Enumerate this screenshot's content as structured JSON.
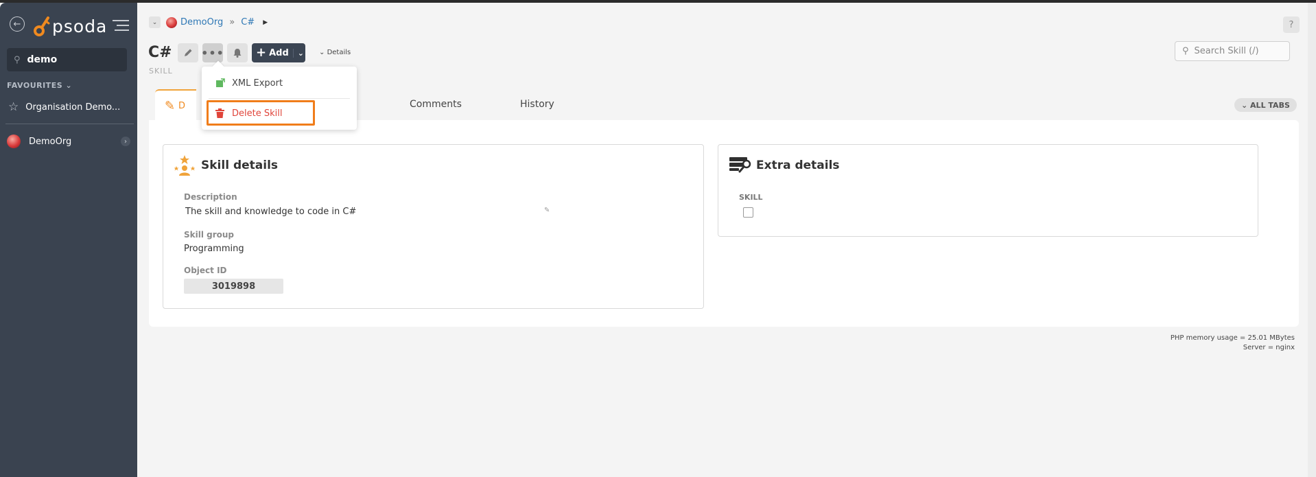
{
  "sidebar": {
    "logo_text": "psoda",
    "search_value": "demo",
    "favourites_heading": "FAVOURITES",
    "favourite_item": "Organisation Demo...",
    "org_item": "DemoOrg"
  },
  "breadcrumb": {
    "org": "DemoOrg",
    "separator": "»",
    "current": "C#"
  },
  "header": {
    "title": "C#",
    "subtitle": "SKILL",
    "add_label": "Add",
    "details_label": "Details",
    "search_placeholder": "Search Skill (/)",
    "help_label": "?"
  },
  "menu": {
    "xml_export": "XML Export",
    "delete_skill": "Delete Skill"
  },
  "tabs": {
    "active_label": "D",
    "comments": "Comments",
    "history": "History",
    "all_tabs": "ALL TABS"
  },
  "skill_details": {
    "title": "Skill details",
    "description_label": "Description",
    "description_value": "The skill and knowledge to code in C#",
    "skill_group_label": "Skill group",
    "skill_group_value": "Programming",
    "object_id_label": "Object ID",
    "object_id_value": "3019898"
  },
  "extra_details": {
    "title": "Extra details",
    "skill_label": "SKILL",
    "skill_checked": false
  },
  "footer": {
    "memory": "PHP memory usage = 25.01 MBytes",
    "server": "Server = nginx"
  },
  "colors": {
    "sidebar_bg": "#3a4350",
    "accent_orange": "#f08a1f",
    "danger_red": "#e0443a",
    "link_blue": "#2f78b5"
  }
}
